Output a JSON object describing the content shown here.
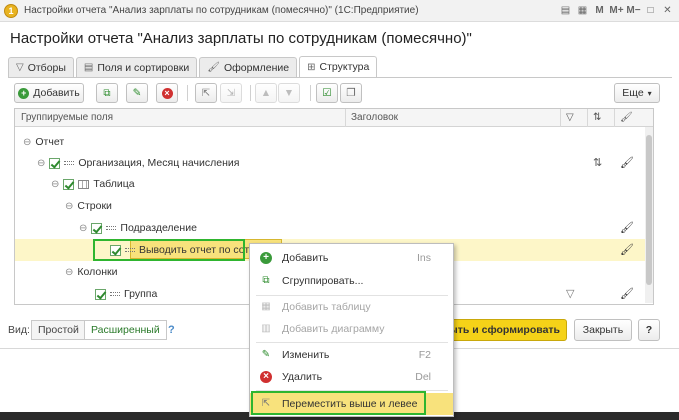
{
  "window": {
    "title": "Настройки отчета \"Анализ зарплаты по сотрудникам (помесячно)\"  (1С:Предприятие)",
    "buttons": [
      "▤",
      "▦",
      "M",
      "M+",
      "M−",
      "□",
      "✕"
    ]
  },
  "page_title": "Настройки отчета \"Анализ зарплаты по сотрудникам (помесячно)\"",
  "tabs": [
    {
      "label": "Отборы",
      "icon": "filter-icon"
    },
    {
      "label": "Поля и сортировки",
      "icon": "fields-icon"
    },
    {
      "label": "Оформление",
      "icon": "brush-icon"
    },
    {
      "label": "Структура",
      "icon": "structure-icon",
      "active": true
    }
  ],
  "toolbar": {
    "add_label": "Добавить",
    "more_label": "Еще"
  },
  "grid": {
    "headers": {
      "fields": "Группируемые поля",
      "title": "Заголовок"
    },
    "rows": [
      {
        "label": "Отчет"
      },
      {
        "label": "Организация, Месяц начисления"
      },
      {
        "label": "Таблица"
      },
      {
        "label": "Строки"
      },
      {
        "label": "Подразделение"
      },
      {
        "label": "Выводить отчет по сотр"
      },
      {
        "label": "Колонки"
      },
      {
        "label": "Группа"
      }
    ]
  },
  "footer": {
    "view_label": "Вид:",
    "simple": "Простой",
    "extended": "Расширенный",
    "help": "?",
    "run_label": "ыть и сформировать",
    "close_label": "Закрыть",
    "help2": "?"
  },
  "context_menu": {
    "items": [
      {
        "label": "Добавить",
        "key": "Ins"
      },
      {
        "label": "Сгруппировать..."
      },
      {
        "label": "Добавить таблицу"
      },
      {
        "label": "Добавить диаграмму"
      },
      {
        "label": "Изменить",
        "key": "F2"
      },
      {
        "label": "Удалить",
        "key": "Del"
      },
      {
        "label": "Переместить выше и левее"
      }
    ]
  }
}
